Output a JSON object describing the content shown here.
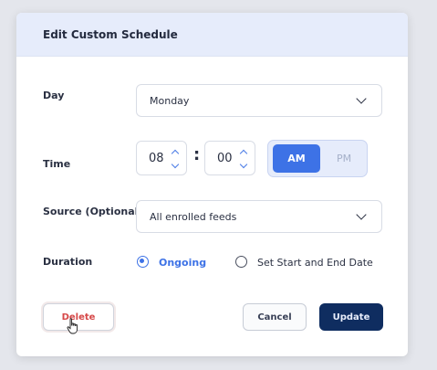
{
  "modal": {
    "title": "Edit Custom Schedule"
  },
  "day": {
    "label": "Day",
    "value": "Monday"
  },
  "time": {
    "label": "Time",
    "hour": "08",
    "minute": "00",
    "am_label": "AM",
    "pm_label": "PM",
    "selected_period": "AM"
  },
  "source": {
    "label": "Source (Optional)",
    "value": "All enrolled feeds"
  },
  "duration": {
    "label": "Duration",
    "options": [
      {
        "label": "Ongoing",
        "selected": true
      },
      {
        "label": "Set Start and End Date",
        "selected": false
      }
    ]
  },
  "buttons": {
    "delete": "Delete",
    "cancel": "Cancel",
    "update": "Update"
  },
  "colors": {
    "accent": "#3d72e6",
    "primary_button": "#0f2d60",
    "danger_text": "#d64848",
    "header_bg": "#e6ecfb"
  },
  "icons": {
    "chevron": "chevron-down-icon",
    "stepper_up": "chevron-up-icon",
    "stepper_down": "chevron-down-icon",
    "cursor": "hand-pointer-cursor-icon"
  }
}
